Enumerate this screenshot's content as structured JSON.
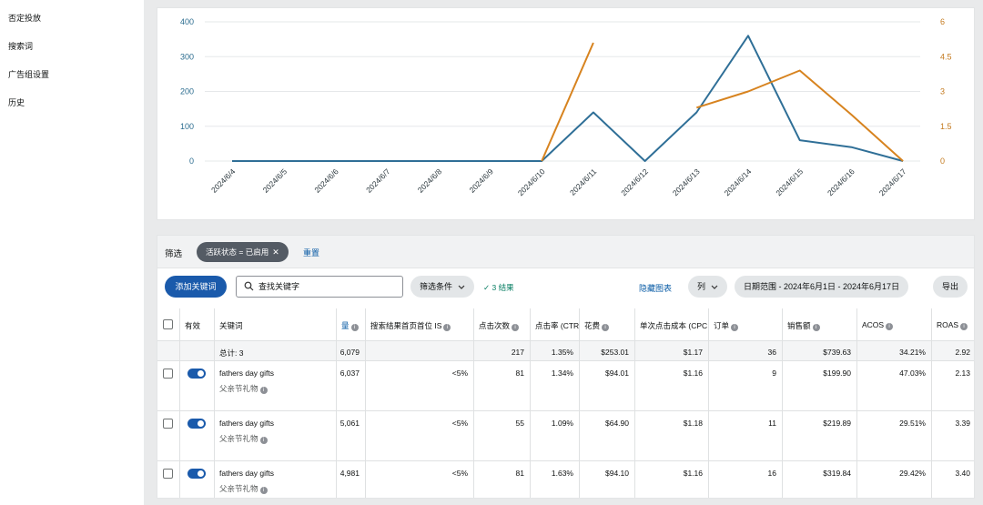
{
  "sidebar": {
    "items": [
      {
        "label": "否定投放"
      },
      {
        "label": "搜索词"
      },
      {
        "label": "广告组设置"
      },
      {
        "label": "历史"
      }
    ]
  },
  "chart_data": {
    "type": "line",
    "x": [
      "2024/6/4",
      "2024/6/5",
      "2024/6/6",
      "2024/6/7",
      "2024/6/8",
      "2024/6/9",
      "2024/6/10",
      "2024/6/11",
      "2024/6/12",
      "2024/6/13",
      "2024/6/14",
      "2024/6/15",
      "2024/6/16",
      "2024/6/17"
    ],
    "y_left": {
      "ticks": [
        "0",
        "100",
        "200",
        "300",
        "400"
      ],
      "range": [
        0,
        400
      ]
    },
    "y_right": {
      "ticks": [
        "0",
        "1.5",
        "3",
        "4.5",
        "6"
      ],
      "range": [
        0,
        6
      ]
    },
    "series": [
      {
        "axis": "left",
        "color": "#2f6f97",
        "values": [
          0,
          0,
          0,
          0,
          0,
          0,
          0,
          140,
          0,
          140,
          360,
          60,
          40,
          0
        ]
      },
      {
        "axis": "right",
        "color": "#d7831f",
        "values": [
          null,
          null,
          null,
          null,
          null,
          null,
          0,
          5.1,
          null,
          2.3,
          3,
          3.9,
          2,
          0
        ]
      }
    ],
    "grid": true
  },
  "filter": {
    "label": "筛选",
    "chip": "活跃状态 = 已启用",
    "chip_close": "✕",
    "reset": "重置"
  },
  "toolbar": {
    "add_keyword": "添加关键词",
    "search_placeholder": "查找关键字",
    "filter_conditions": "筛选条件",
    "results": "✓ 3 结果",
    "hide_chart": "隐藏图表",
    "columns": "列",
    "date_range": "日期范围 - 2024年6月1日 - 2024年6月17日",
    "export": "导出"
  },
  "table": {
    "headers": {
      "active": "有效",
      "keyword": "关键词",
      "impressions": "量",
      "top_is": "搜索结果首页首位 IS",
      "clicks": "点击次数",
      "ctr": "点击率 (CTR",
      "spend": "花费",
      "cpc": "单次点击成本 (CPC",
      "orders": "订单",
      "sales": "销售额",
      "acos": "ACOS",
      "roas": "ROAS"
    },
    "total": {
      "label": "总计: 3",
      "impressions": "6,079",
      "clicks": "217",
      "ctr": "1.35%",
      "spend": "$253.01",
      "cpc": "$1.17",
      "orders": "36",
      "sales": "$739.63",
      "acos": "34.21%",
      "roas": "2.92"
    },
    "rows": [
      {
        "keyword": "fathers day gifts",
        "sub": "父亲节礼物",
        "impressions": "6,037",
        "top_is": "<5%",
        "clicks": "81",
        "ctr": "1.34%",
        "spend": "$94.01",
        "cpc": "$1.16",
        "orders": "9",
        "sales": "$199.90",
        "acos": "47.03%",
        "roas": "2.13"
      },
      {
        "keyword": "fathers day gifts",
        "sub": "父亲节礼物",
        "impressions": "5,061",
        "top_is": "<5%",
        "clicks": "55",
        "ctr": "1.09%",
        "spend": "$64.90",
        "cpc": "$1.18",
        "orders": "11",
        "sales": "$219.89",
        "acos": "29.51%",
        "roas": "3.39"
      },
      {
        "keyword": "fathers day gifts",
        "sub": "父亲节礼物",
        "impressions": "4,981",
        "top_is": "<5%",
        "clicks": "81",
        "ctr": "1.63%",
        "spend": "$94.10",
        "cpc": "$1.16",
        "orders": "16",
        "sales": "$319.84",
        "acos": "29.42%",
        "roas": "3.40"
      }
    ]
  }
}
